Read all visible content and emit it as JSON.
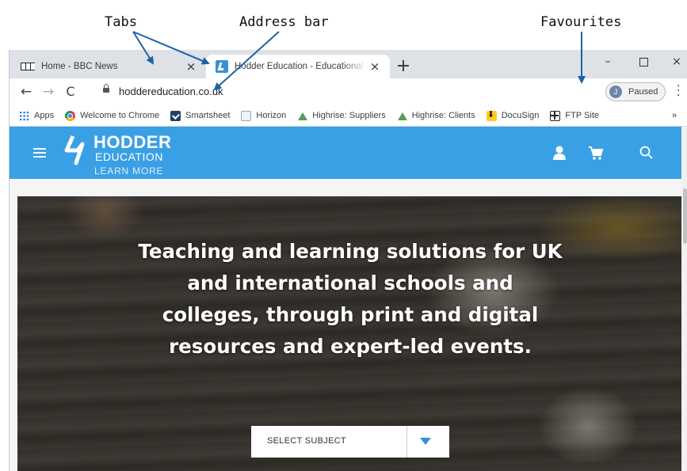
{
  "annotations": {
    "tabs": "Tabs",
    "address_bar": "Address bar",
    "favourites": "Favourites"
  },
  "browser": {
    "tabs": [
      {
        "title": "Home - BBC News",
        "active": false,
        "icon": "bbc-icon"
      },
      {
        "title": "Hodder Education - Educational R",
        "active": true,
        "icon": "hodder-icon"
      }
    ],
    "close_glyph": "×",
    "new_tab_glyph": "+",
    "window_controls": {
      "minimize": "–",
      "close": "×"
    },
    "url": "hoddereducation.co.uk",
    "profile": {
      "initial": "J",
      "status": "Paused"
    },
    "bookmarks": [
      {
        "label": "Apps",
        "icon": "apps-grid-icon"
      },
      {
        "label": "Welcome to Chrome",
        "icon": "chrome-icon"
      },
      {
        "label": "Smartsheet",
        "icon": "smartsheet-icon"
      },
      {
        "label": "Horizon",
        "icon": "horizon-icon"
      },
      {
        "label": "Highrise: Suppliers",
        "icon": "highrise-icon"
      },
      {
        "label": "Highrise: Clients",
        "icon": "highrise-icon"
      },
      {
        "label": "DocuSign",
        "icon": "docusign-icon"
      },
      {
        "label": "FTP Site",
        "icon": "ftp-grid-icon"
      }
    ],
    "bookmarks_more": "»"
  },
  "site": {
    "logo": {
      "name": "HODDER",
      "sub": "EDUCATION",
      "tagline": "LEARN MORE"
    },
    "hero_text": "Teaching and learning solutions for UK and international schools and colleges, through print and digital resources and expert-led events.",
    "select_subject": "SELECT SUBJECT",
    "colors": {
      "header": "#3aa0e6",
      "accent": "#3a8fd6"
    }
  }
}
